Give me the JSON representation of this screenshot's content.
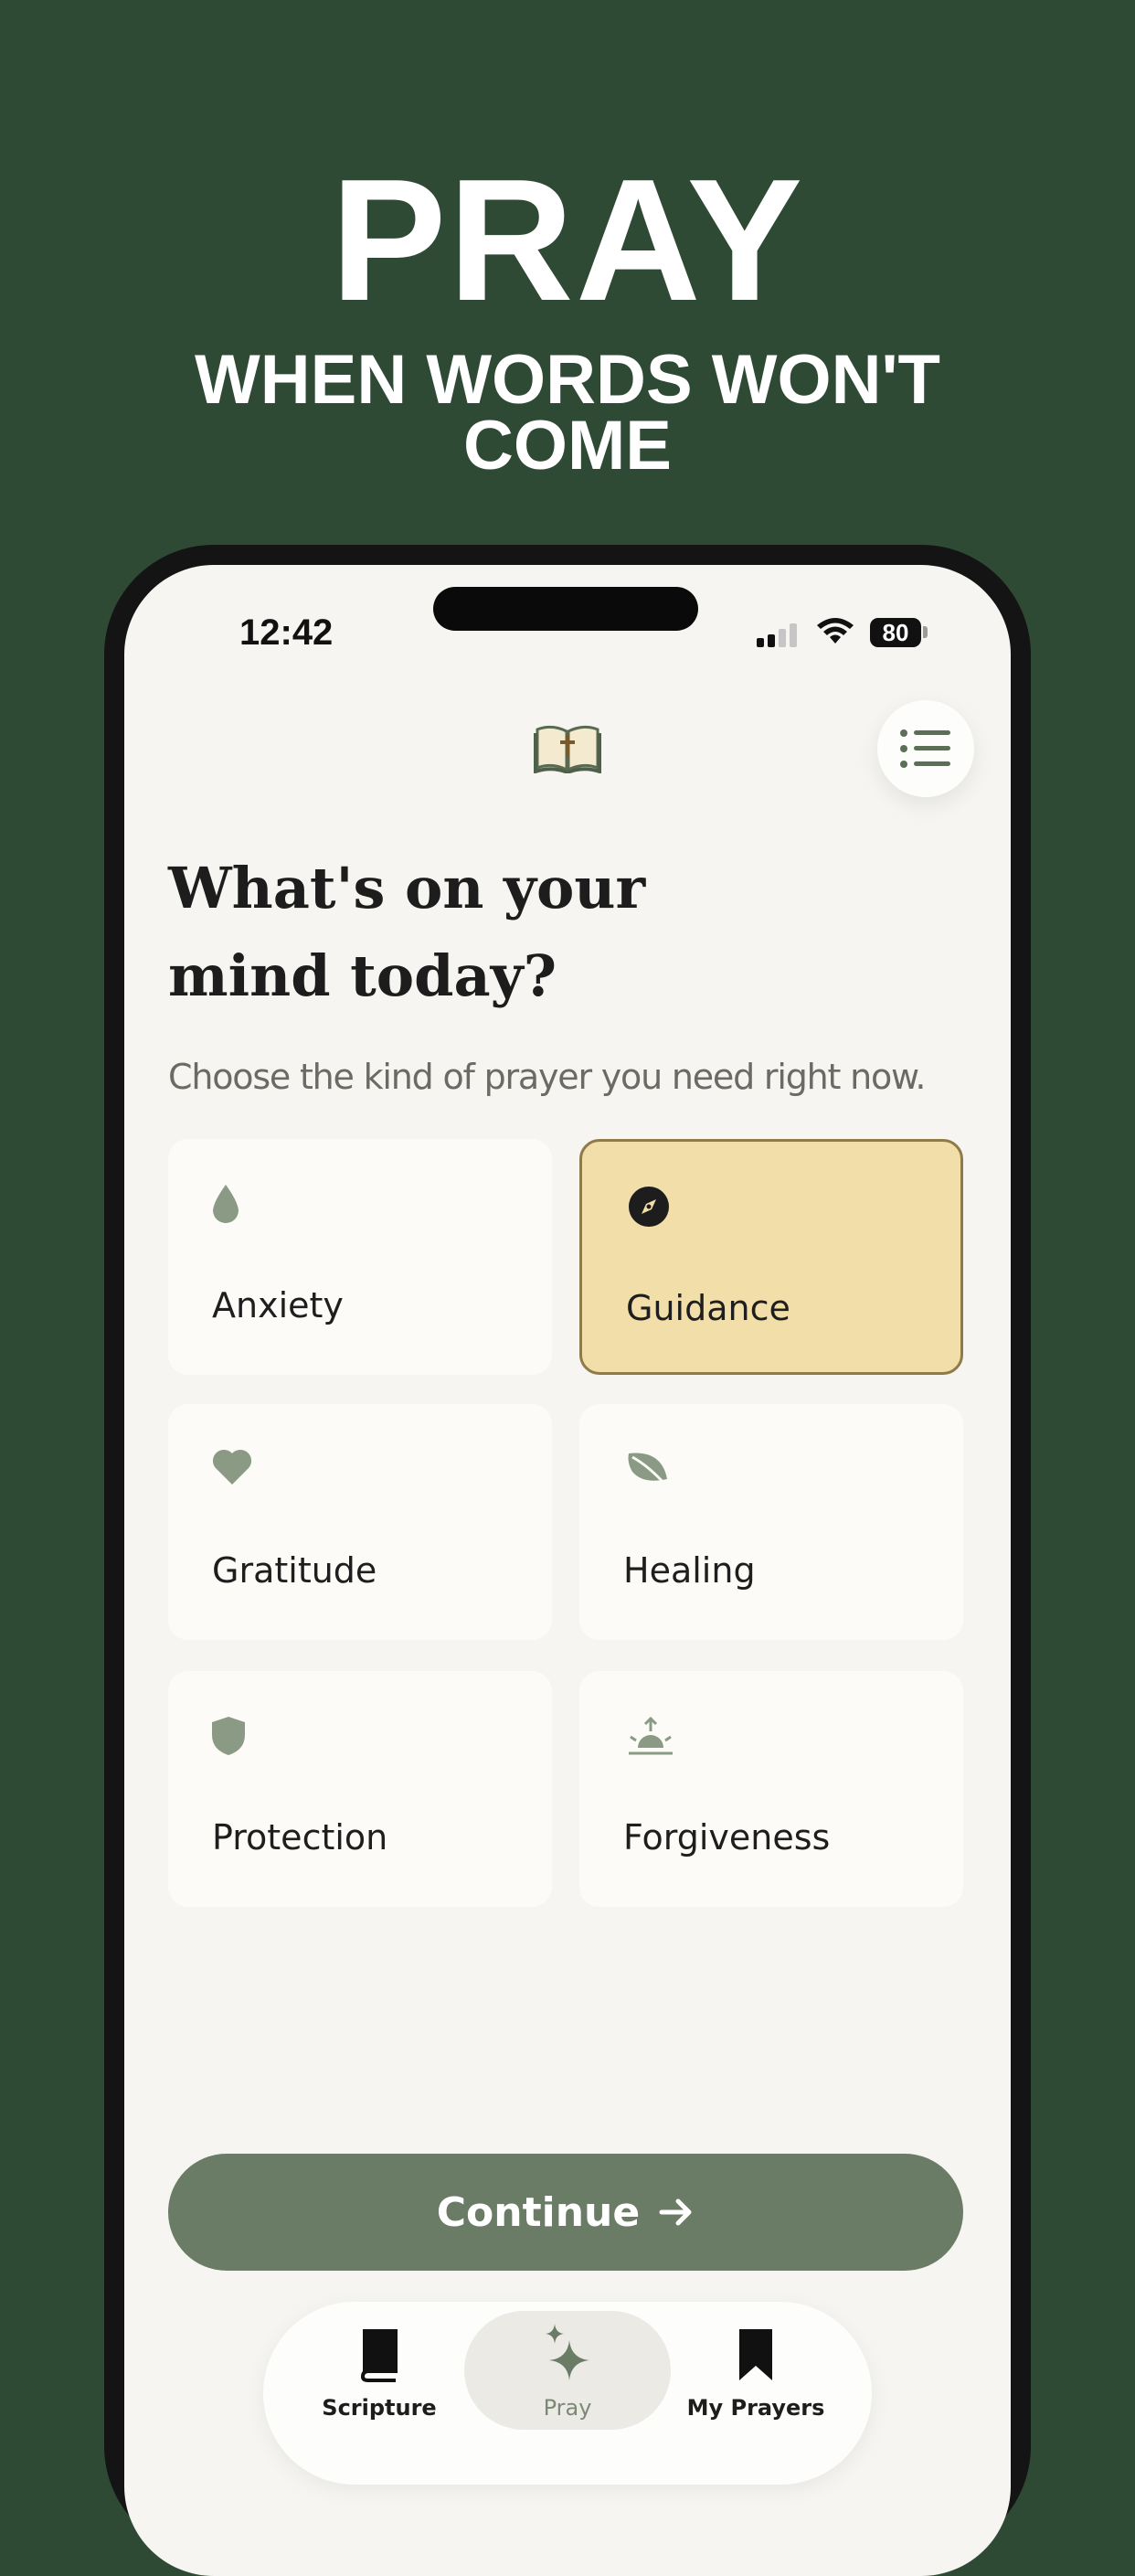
{
  "promo": {
    "title": "PRAY",
    "subtitle": "WHEN WORDS WON'T COME"
  },
  "status_bar": {
    "time": "12:42",
    "battery": "80"
  },
  "header": {
    "logo_icon": "open-bible-cross-icon",
    "menu_icon": "list-menu-icon"
  },
  "main": {
    "heading": "What's on your mind today?",
    "subheading": "Choose the kind of prayer you need right now.",
    "categories": [
      {
        "label": "Anxiety",
        "icon": "water-drop-icon",
        "selected": false
      },
      {
        "label": "Guidance",
        "icon": "compass-icon",
        "selected": true
      },
      {
        "label": "Gratitude",
        "icon": "heart-icon",
        "selected": false
      },
      {
        "label": "Healing",
        "icon": "leaf-icon",
        "selected": false
      },
      {
        "label": "Protection",
        "icon": "shield-icon",
        "selected": false
      },
      {
        "label": "Forgiveness",
        "icon": "sunrise-icon",
        "selected": false
      }
    ],
    "continue_label": "Continue"
  },
  "tabbar": {
    "tabs": [
      {
        "label": "Scripture",
        "icon": "book-icon",
        "active": false
      },
      {
        "label": "Pray",
        "icon": "sparkles-icon",
        "active": true
      },
      {
        "label": "My Prayers",
        "icon": "bookmark-icon",
        "active": false
      }
    ]
  },
  "colors": {
    "background": "#2e4a34",
    "accent": "#6b7c66",
    "selected_card": "#f2dea8",
    "icon_muted": "#8a9a84"
  }
}
